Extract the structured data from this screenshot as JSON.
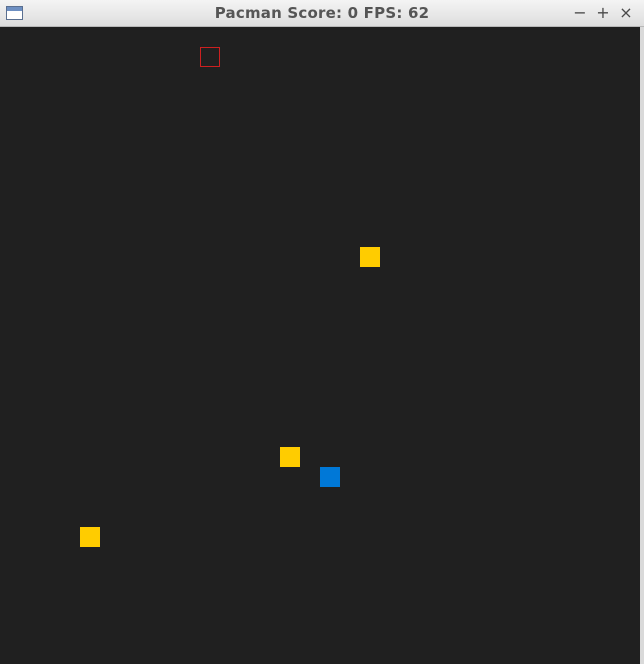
{
  "window": {
    "title": "Pacman Score: 0 FPS: 62",
    "buttons": {
      "minimize": "−",
      "maximize": "+",
      "close": "×"
    }
  },
  "colors": {
    "playfield": "#202020",
    "pellet": "#ffcc00",
    "player": "#0078d7",
    "ghost_outline": "#cc2020"
  },
  "game": {
    "score": 0,
    "fps": 62,
    "pellet_count": 3,
    "player_count": 1,
    "ghost_count": 1
  }
}
